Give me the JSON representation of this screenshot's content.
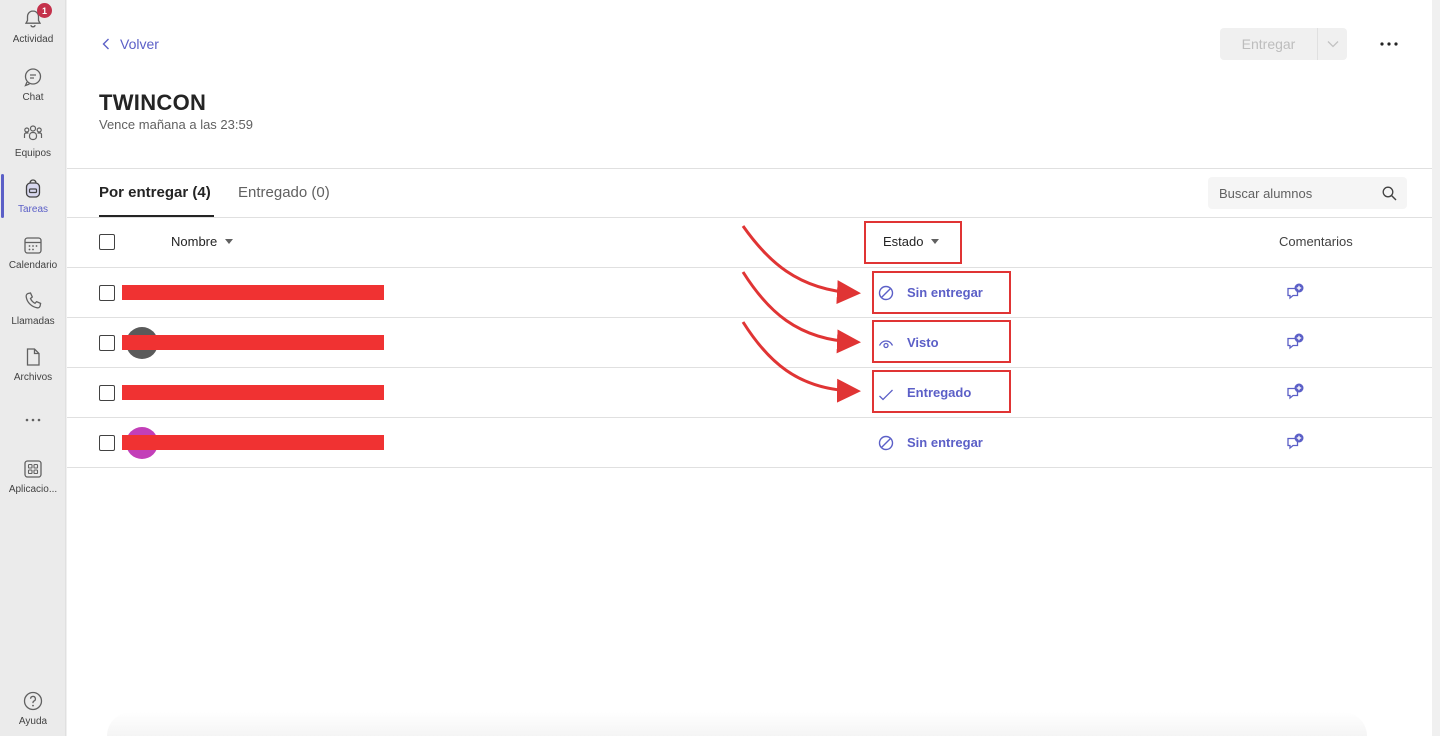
{
  "rail": {
    "items": [
      {
        "label": "Actividad",
        "icon": "bell-icon",
        "badge": "1"
      },
      {
        "label": "Chat",
        "icon": "chat-icon"
      },
      {
        "label": "Equipos",
        "icon": "teams-icon"
      },
      {
        "label": "Tareas",
        "icon": "backpack-icon",
        "active": true
      },
      {
        "label": "Calendario",
        "icon": "calendar-icon"
      },
      {
        "label": "Llamadas",
        "icon": "phone-icon"
      },
      {
        "label": "Archivos",
        "icon": "file-icon"
      },
      {
        "label": "",
        "icon": "more-horizontal-icon"
      },
      {
        "label": "Aplicacio...",
        "icon": "apps-icon"
      },
      {
        "label": "Ayuda",
        "icon": "help-icon"
      }
    ]
  },
  "header": {
    "back_label": "Volver",
    "submit_label": "Entregar",
    "title": "TWINCON",
    "due": "Vence mañana a las 23:59"
  },
  "tabs": [
    {
      "label": "Por entregar (4)",
      "active": true
    },
    {
      "label": "Entregado (0)",
      "active": false
    }
  ],
  "search": {
    "placeholder": "Buscar alumnos"
  },
  "table": {
    "columns": {
      "name": "Nombre",
      "status": "Estado",
      "comments": "Comentarios"
    },
    "rows": [
      {
        "status": "Sin entregar",
        "status_icon": "blocked-icon"
      },
      {
        "status": "Visto",
        "status_icon": "eye-icon"
      },
      {
        "status": "Entregado",
        "status_icon": "checkmark-icon"
      },
      {
        "status": "Sin entregar",
        "status_icon": "blocked-icon"
      }
    ]
  },
  "colors": {
    "accent": "#5b5fc7",
    "annotation": "#e03434",
    "redaction": "#f03232"
  }
}
